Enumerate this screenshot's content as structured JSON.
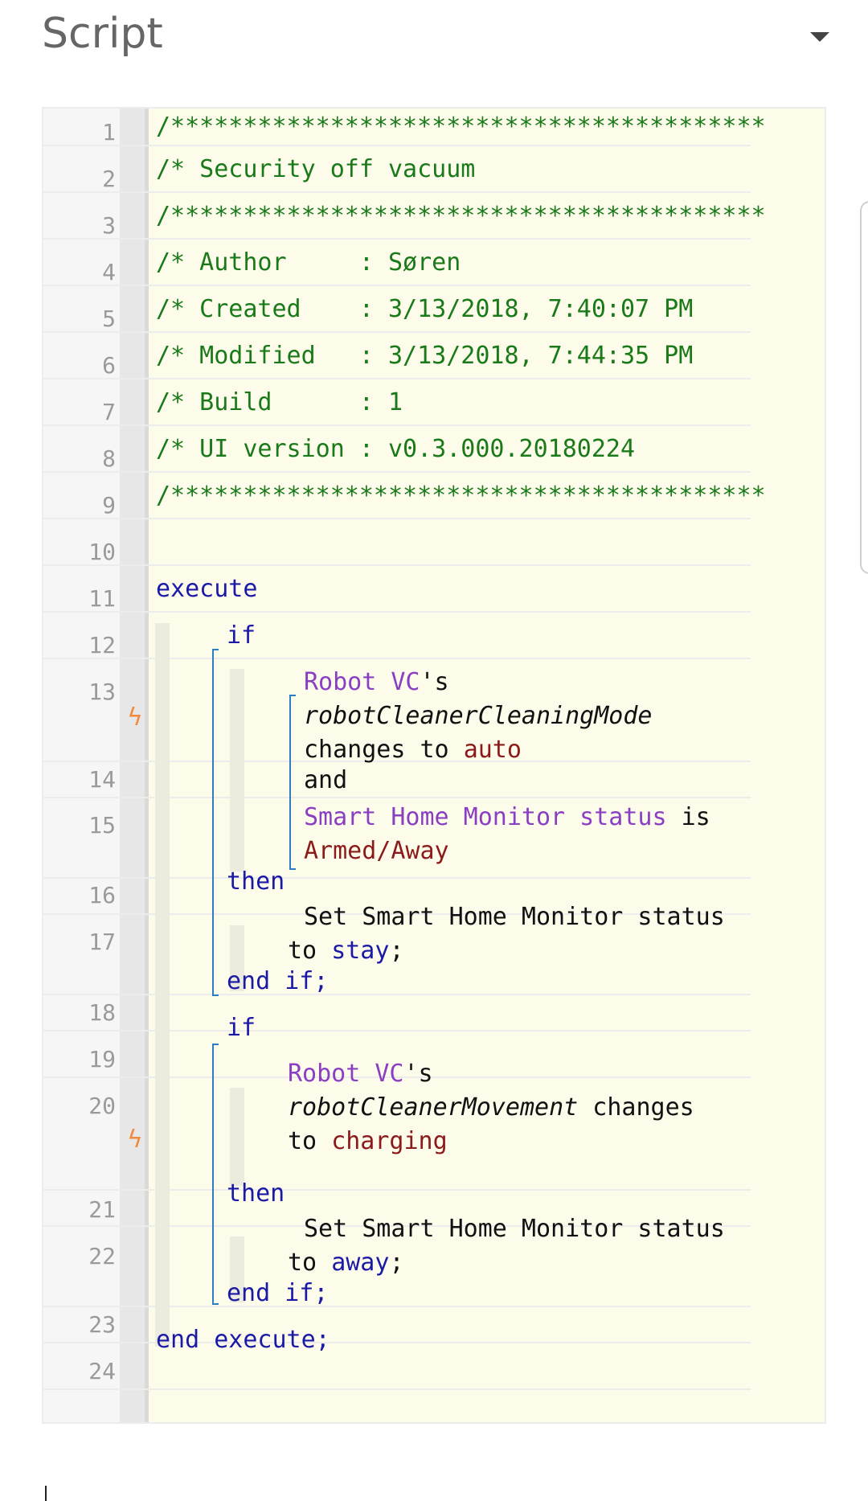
{
  "header": {
    "title": "Script"
  },
  "lines": {
    "l1": "/*****************************************",
    "l2": "/* Security off vacuum",
    "l3": "/*****************************************",
    "l4": "/* Author     : Søren",
    "l5": "/* Created    : 3/13/2018, 7:40:07 PM",
    "l6": "/* Modified   : 3/13/2018, 7:44:35 PM",
    "l7": "/* Build      : 1",
    "l8": "/* UI version : v0.3.000.20180224",
    "l9": "/*****************************************",
    "execute": "execute",
    "if1": "if",
    "dev1": "Robot VC",
    "poss": "'s",
    "attr1": "robotCleanerCleaningMode",
    "changes_to": "changes to",
    "auto": "auto",
    "and": "and",
    "shm_status": "Smart Home Monitor status",
    "is": "is",
    "armed_away": "Armed/Away",
    "then": "then",
    "set_shm": "Set Smart Home Monitor status",
    "to": "to",
    "stay": "stay",
    "semi": ";",
    "end_if": "end if;",
    "if2": "if",
    "dev2": "Robot VC",
    "attr2": "robotCleanerMovement",
    "changes": "changes",
    "charging": "charging",
    "then2": "then",
    "set_shm2": "Set Smart Home Monitor status",
    "away": "away",
    "end_if2": "end if;",
    "end_execute": "end execute;"
  },
  "line_numbers": [
    "1",
    "2",
    "3",
    "4",
    "5",
    "6",
    "7",
    "8",
    "9",
    "10",
    "11",
    "12",
    "13",
    "14",
    "15",
    "16",
    "17",
    "18",
    "19",
    "20",
    "21",
    "22",
    "23",
    "24"
  ],
  "icons": {
    "collapse": "chevron-down-icon",
    "trigger": "lightning-bolt-icon"
  },
  "colors": {
    "comment": "#1a7a1a",
    "keyword": "#1a1aa6",
    "device": "#8a3fc2",
    "value": "#8b1a1a",
    "editor_bg": "#fdfcea",
    "trigger": "#f08a3c"
  }
}
